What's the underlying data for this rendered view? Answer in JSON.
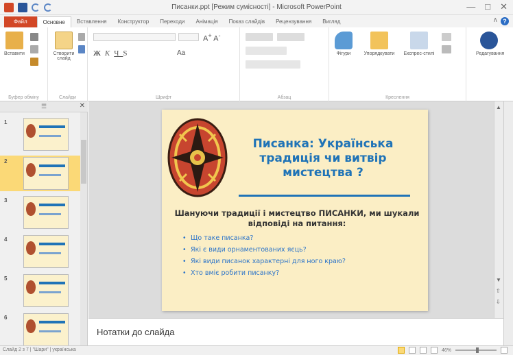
{
  "window": {
    "title": "Писанки.ppt [Режим сумісності] - Microsoft PowerPoint"
  },
  "tabs": [
    {
      "label": "Файл",
      "kind": "file"
    },
    {
      "label": "Основне",
      "kind": "active"
    },
    {
      "label": "Вставлення",
      "kind": ""
    },
    {
      "label": "Конструктор",
      "kind": ""
    },
    {
      "label": "Переходи",
      "kind": ""
    },
    {
      "label": "Анімація",
      "kind": ""
    },
    {
      "label": "Показ слайдів",
      "kind": ""
    },
    {
      "label": "Рецензування",
      "kind": ""
    },
    {
      "label": "Вигляд",
      "kind": ""
    }
  ],
  "ribbon": {
    "groups": {
      "clipboard": "Буфер обміну",
      "slides": "Слайди",
      "font": "Шрифт",
      "paragraph": "Абзац",
      "drawing": "Креслення"
    },
    "buttons": {
      "paste": "Вставити",
      "new_slide": "Створити слайд",
      "shapes": "Фігури",
      "arrange": "Упорядкувати",
      "quick_styles": "Експрес-стилі",
      "editing": "Редагування"
    },
    "font_sample": "Aa"
  },
  "thumbnails": [
    {
      "num": "1",
      "selected": false
    },
    {
      "num": "2",
      "selected": true
    },
    {
      "num": "3",
      "selected": false
    },
    {
      "num": "4",
      "selected": false
    },
    {
      "num": "5",
      "selected": false
    },
    {
      "num": "6",
      "selected": false
    }
  ],
  "slide": {
    "title": "Писанка: Українська традиція чи витвір мистецтва ?",
    "subtitle": "Шануючи традиції і мистецтво ПИСАНКИ, ми шукали відповіді на питання:",
    "bullets": [
      "Що таке писанка?",
      "Які є види орнаментованих яєць?",
      "Які види писанок характерні для ного краю?",
      "Хто вміє робити писанку?"
    ]
  },
  "notes": {
    "placeholder": "Нотатки до слайда"
  },
  "status": {
    "slide_info": "Слайд 2 з 7 | \"Шари\" | українська",
    "zoom": "46%"
  },
  "colors": {
    "accent": "#d24726",
    "slide_title": "#1f73b7",
    "slide_bg": "#fbeec5",
    "selected_thumb": "#fbd977"
  }
}
